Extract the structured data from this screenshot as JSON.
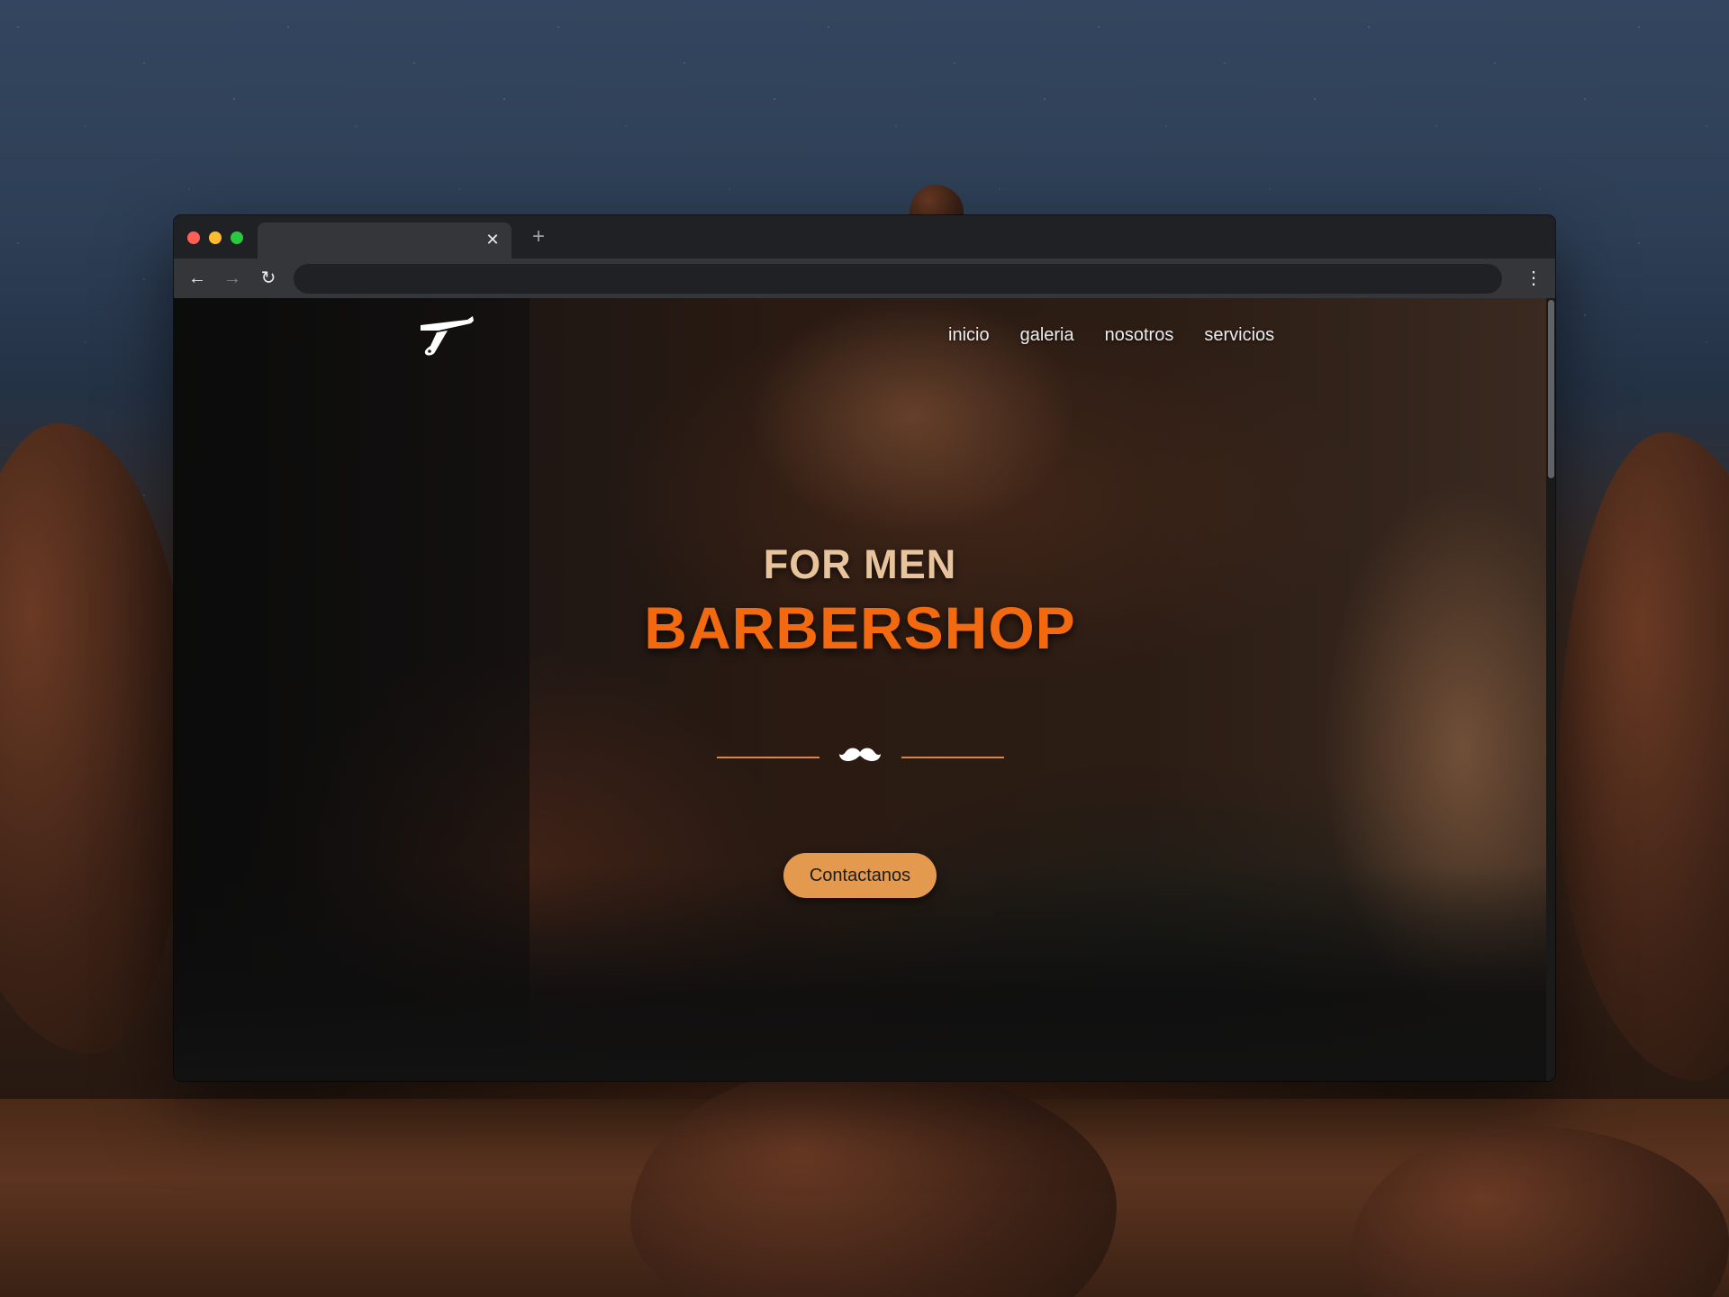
{
  "browser": {
    "tab_title": "",
    "tab_close": "✕",
    "new_tab": "+",
    "address": "",
    "back": "←",
    "forward": "→",
    "reload": "↻",
    "menu": "⋮"
  },
  "site": {
    "logo_icon": "straight-razor-icon",
    "nav": [
      {
        "label": "inicio"
      },
      {
        "label": "galeria"
      },
      {
        "label": "nosotros"
      },
      {
        "label": "servicios"
      }
    ],
    "hero": {
      "kicker": "FOR MEN",
      "title": "BARBERSHOP",
      "divider_icon": "mustache-icon",
      "cta": "Contactanos"
    }
  },
  "colors": {
    "kicker": "#e7c49b",
    "title": "#f2690f",
    "cta_bg": "#e39a4e",
    "divider": "#d8844a",
    "browser_frame": "#202124",
    "toolbar": "#35363a"
  }
}
